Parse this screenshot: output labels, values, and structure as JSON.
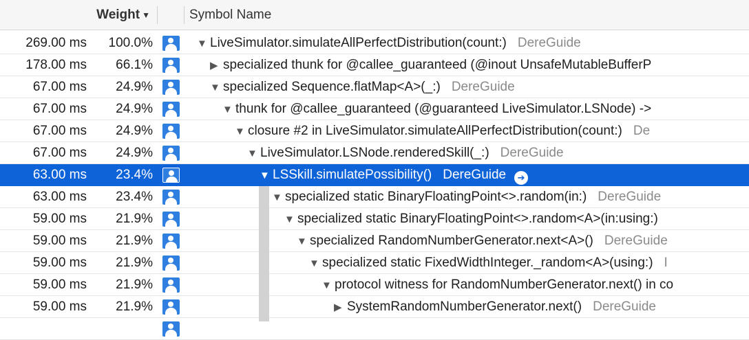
{
  "header": {
    "weight_label": "Weight",
    "sort_icon": "chevron-down-icon",
    "symbol_label": "Symbol Name"
  },
  "rows": [
    {
      "ms": "269.00 ms",
      "pct": "100.0%",
      "tri": "▼",
      "symbol": "LiveSimulator.simulateAllPerfectDistribution(count:)",
      "lib": "DereGuide"
    },
    {
      "ms": "178.00 ms",
      "pct": "66.1%",
      "tri": "▶",
      "symbol": "specialized thunk for @callee_guaranteed (@inout UnsafeMutableBufferP",
      "lib": ""
    },
    {
      "ms": "67.00 ms",
      "pct": "24.9%",
      "tri": "▼",
      "symbol": "specialized Sequence.flatMap<A>(_:)",
      "lib": "DereGuide"
    },
    {
      "ms": "67.00 ms",
      "pct": "24.9%",
      "tri": "▼",
      "symbol": "thunk for @callee_guaranteed (@guaranteed LiveSimulator.LSNode) ->",
      "lib": ""
    },
    {
      "ms": "67.00 ms",
      "pct": "24.9%",
      "tri": "▼",
      "symbol": "closure #2 in LiveSimulator.simulateAllPerfectDistribution(count:)",
      "lib": "De"
    },
    {
      "ms": "67.00 ms",
      "pct": "24.9%",
      "tri": "▼",
      "symbol": "LiveSimulator.LSNode.renderedSkill(_:)",
      "lib": "DereGuide"
    },
    {
      "ms": "63.00 ms",
      "pct": "23.4%",
      "tri": "▼",
      "symbol": "LSSkill.simulatePossibility()",
      "lib": "DereGuide"
    },
    {
      "ms": "63.00 ms",
      "pct": "23.4%",
      "tri": "▼",
      "symbol": "specialized static BinaryFloatingPoint<>.random(in:)",
      "lib": "DereGuide"
    },
    {
      "ms": "59.00 ms",
      "pct": "21.9%",
      "tri": "▼",
      "symbol": "specialized static BinaryFloatingPoint<>.random<A>(in:using:)",
      "lib": ""
    },
    {
      "ms": "59.00 ms",
      "pct": "21.9%",
      "tri": "▼",
      "symbol": "specialized RandomNumberGenerator.next<A>()",
      "lib": "DereGuide"
    },
    {
      "ms": "59.00 ms",
      "pct": "21.9%",
      "tri": "▼",
      "symbol": "specialized static FixedWidthInteger._random<A>(using:)",
      "lib": "I"
    },
    {
      "ms": "59.00 ms",
      "pct": "21.9%",
      "tri": "▼",
      "symbol": "protocol witness for RandomNumberGenerator.next() in co",
      "lib": ""
    },
    {
      "ms": "59.00 ms",
      "pct": "21.9%",
      "tri": "▶",
      "symbol": "SystemRandomNumberGenerator.next()",
      "lib": "DereGuide"
    },
    {
      "ms": "",
      "pct": "",
      "tri": "",
      "symbol": "",
      "lib": ""
    }
  ],
  "selected_row": 6,
  "icons": {
    "user": "user-icon",
    "go": "arrow-right-circle-icon"
  },
  "colors": {
    "selection": "#0f63d8",
    "library_text": "#8a8a8a",
    "user_icon": "#2f7fe0"
  }
}
